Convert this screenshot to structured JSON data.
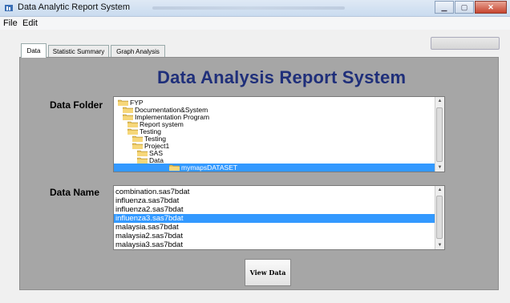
{
  "window": {
    "title": "Data Analytic Report System",
    "controls": [
      "minimize",
      "maximize",
      "close"
    ]
  },
  "menubar": {
    "items": [
      "File",
      "Edit"
    ]
  },
  "tabs": [
    {
      "label": "Data",
      "active": true
    },
    {
      "label": "Statistic Summary",
      "active": false
    },
    {
      "label": "Graph Analysis",
      "active": false
    }
  ],
  "panel": {
    "heading": "Data Analysis Report System",
    "data_folder": {
      "label": "Data Folder",
      "tree": [
        {
          "label": "FYP",
          "depth": 0
        },
        {
          "label": "Documentation&System",
          "depth": 1
        },
        {
          "label": "Implementation Program",
          "depth": 1
        },
        {
          "label": "Report system",
          "depth": 2
        },
        {
          "label": "Testing",
          "depth": 2
        },
        {
          "label": "Testing",
          "depth": 3
        },
        {
          "label": "Project1",
          "depth": 3
        },
        {
          "label": "SAS",
          "depth": 4
        },
        {
          "label": "Data",
          "depth": 4
        },
        {
          "label": "mymapsDATASET",
          "depth": 5,
          "selected": true
        }
      ]
    },
    "data_name": {
      "label": "Data Name",
      "files": [
        {
          "label": "combination.sas7bdat"
        },
        {
          "label": "influenza.sas7bdat"
        },
        {
          "label": "influenza2.sas7bdat"
        },
        {
          "label": "influenza3.sas7bdat",
          "selected": true
        },
        {
          "label": "malaysia.sas7bdat"
        },
        {
          "label": "malaysia2.sas7bdat"
        },
        {
          "label": "malaysia3.sas7bdat"
        }
      ]
    },
    "view_button": "View Data"
  },
  "colors": {
    "panel": "#a6a6a6",
    "heading": "#1f2f7a",
    "selection": "#3399ff"
  }
}
